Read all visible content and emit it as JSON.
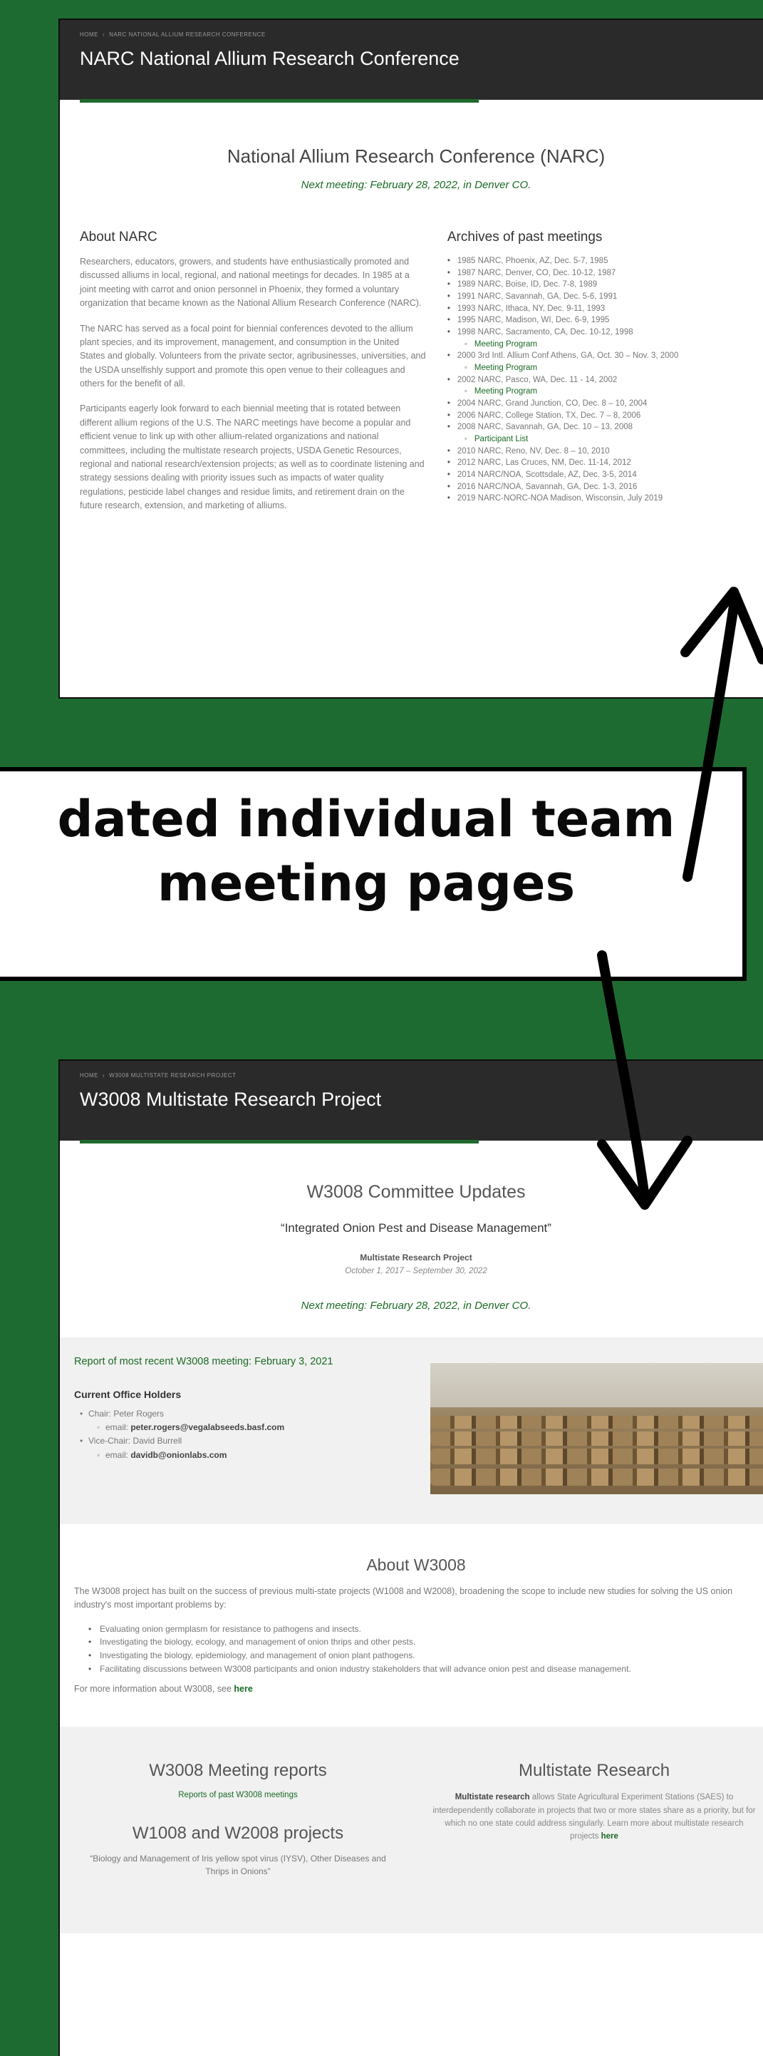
{
  "narc_page": {
    "breadcrumb": [
      "HOME",
      "NARC NATIONAL ALLIUM RESEARCH CONFERENCE"
    ],
    "header_title": "NARC National Allium Research Conference",
    "center_title": "National Allium Research Conference (NARC)",
    "next_meeting": "Next meeting: February 28, 2022, in Denver CO.",
    "about_heading": "About NARC",
    "about_paragraphs": [
      "Researchers, educators, growers, and students have enthusiastically promoted and discussed alliums in local, regional, and national meetings for decades. In 1985 at a joint meeting with carrot and onion personnel in Phoenix, they formed a voluntary organization that became known as the National Allium Research Conference (NARC).",
      "The NARC has served as a focal point for biennial conferences devoted to the allium plant species, and its improvement, management, and consumption in the United States and globally. Volunteers from the private sector, agribusinesses, universities, and the USDA unselfishly support and promote this open venue to their colleagues and others for the benefit of all.",
      "Participants eagerly look forward to each biennial meeting that is rotated between different allium regions of the U.S. The NARC meetings have become a popular and efficient venue to link up with other allium-related organizations and national committees, including the multistate research projects, USDA Genetic Resources, regional and national research/extension projects; as well as to coordinate listening and strategy sessions dealing with priority issues such as impacts of water quality regulations, pesticide label changes and residue limits, and retirement drain on the future research, extension, and marketing of alliums."
    ],
    "archives_heading": "Archives of past meetings",
    "archives": [
      {
        "text": "1985 NARC, Phoenix, AZ, Dec. 5-7, 1985",
        "sub": false
      },
      {
        "text": "1987 NARC, Denver, CO, Dec. 10-12, 1987",
        "sub": false
      },
      {
        "text": "1989 NARC, Boise, ID, Dec. 7-8, 1989",
        "sub": false
      },
      {
        "text": "1991 NARC, Savannah, GA, Dec. 5-6, 1991",
        "sub": false
      },
      {
        "text": "1993 NARC, Ithaca, NY, Dec. 9-11, 1993",
        "sub": false
      },
      {
        "text": "1995 NARC, Madison, WI, Dec. 6-9, 1995",
        "sub": false
      },
      {
        "text": "1998 NARC, Sacramento, CA, Dec. 10-12, 1998",
        "sub": false
      },
      {
        "text": "Meeting Program",
        "sub": true
      },
      {
        "text": "2000 3rd Intl. Allium Conf Athens, GA, Oct. 30 – Nov. 3, 2000",
        "sub": false
      },
      {
        "text": "Meeting Program",
        "sub": true
      },
      {
        "text": "2002 NARC, Pasco, WA, Dec. 11 - 14, 2002",
        "sub": false
      },
      {
        "text": "Meeting Program",
        "sub": true
      },
      {
        "text": "2004 NARC, Grand Junction, CO, Dec. 8 – 10, 2004",
        "sub": false
      },
      {
        "text": "2006 NARC, College Station, TX, Dec. 7 – 8, 2006",
        "sub": false
      },
      {
        "text": "2008 NARC, Savannah, GA, Dec. 10 – 13, 2008",
        "sub": false
      },
      {
        "text": "Participant List",
        "sub": true
      },
      {
        "text": "2010 NARC, Reno, NV, Dec. 8 – 10, 2010",
        "sub": false
      },
      {
        "text": "2012 NARC, Las Cruces, NM, Dec. 11-14, 2012",
        "sub": false
      },
      {
        "text": "2014 NARC/NOA, Scottsdale, AZ, Dec. 3-5, 2014",
        "sub": false
      },
      {
        "text": "2016 NARC/NOA, Savannah, GA, Dec. 1-3, 2016",
        "sub": false
      },
      {
        "text": "2019 NARC-NORC-NOA Madison, Wisconsin, July 2019",
        "sub": false
      }
    ]
  },
  "callout": {
    "line1": "dated individual team",
    "line2": "meeting pages"
  },
  "w3008_page": {
    "breadcrumb": [
      "HOME",
      "W3008 MULTISTATE RESEARCH PROJECT"
    ],
    "header_title": "W3008 Multistate Research Project",
    "updates_title": "W3008 Committee Updates",
    "project_quote": "“Integrated Onion Pest and Disease Management”",
    "mrp_label": "Multistate Research Project",
    "dates": "October 1, 2017 – September 30, 2022",
    "next_meeting": "Next meeting: February 28, 2022, in Denver CO.",
    "report_link": "Report of most recent W3008 meeting: February 3, 2021",
    "officers_heading": "Current Office Holders",
    "officers": [
      {
        "label": "Chair: Peter Rogers",
        "sub": false,
        "bold": ""
      },
      {
        "label": "email: ",
        "sub": true,
        "bold": "peter.rogers@vegalabseeds.basf.com"
      },
      {
        "label": "Vice-Chair: David Burrell",
        "sub": false,
        "bold": ""
      },
      {
        "label": "email: ",
        "sub": true,
        "bold": "davidb@onionlabs.com"
      }
    ],
    "about_heading": "About W3008",
    "about_intro": "The W3008 project has built on the success of previous multi-state projects (W1008 and W2008), broadening the scope to include new studies for solving the US onion industry's most important problems by:",
    "objectives": [
      "Evaluating onion germplasm for resistance to pathogens and insects.",
      "Investigating the biology, ecology, and management of onion thrips and other pests.",
      "Investigating the biology, epidemiology, and management of onion plant pathogens.",
      "Facilitating discussions between W3008 participants and onion industry stakeholders that will advance onion pest and disease management."
    ],
    "more_info_text": "For more information about W3008, see ",
    "more_info_link": "here",
    "meeting_reports_heading": "W3008 Meeting reports",
    "meeting_reports_link": "Reports of past W3008 meetings",
    "prior_projects_heading": "W1008 and W2008 projects",
    "prior_projects_text": "“Biology and Management of Iris yellow spot virus (IYSV), Other Diseases and Thrips in Onions”",
    "multistate_heading": "Multistate Research",
    "multistate_bold": "Multistate research",
    "multistate_text": " allows State Agricultural Experiment Stations (SAES) to interdependently collaborate in projects that two or more states share as a priority, but for which no one state could address singularly. Learn more about multistate research projects ",
    "multistate_link": "here"
  },
  "colors": {
    "background": "#1e6b32",
    "header": "#2a2a2a",
    "accent_green": "#1a6b25",
    "arrow": "#000000"
  }
}
